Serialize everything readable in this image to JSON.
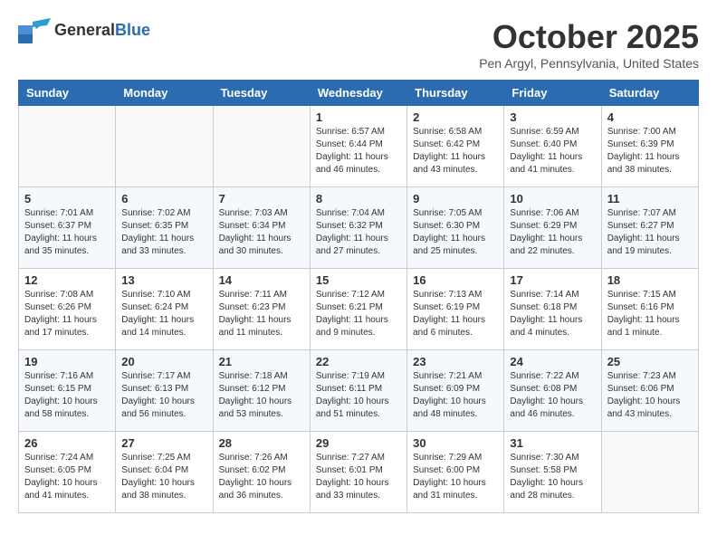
{
  "header": {
    "logo_general": "General",
    "logo_blue": "Blue",
    "month_title": "October 2025",
    "location": "Pen Argyl, Pennsylvania, United States"
  },
  "weekdays": [
    "Sunday",
    "Monday",
    "Tuesday",
    "Wednesday",
    "Thursday",
    "Friday",
    "Saturday"
  ],
  "weeks": [
    [
      {
        "day": "",
        "empty": true
      },
      {
        "day": "",
        "empty": true
      },
      {
        "day": "",
        "empty": true
      },
      {
        "day": "1",
        "sunrise": "6:57 AM",
        "sunset": "6:44 PM",
        "daylight": "11 hours and 46 minutes."
      },
      {
        "day": "2",
        "sunrise": "6:58 AM",
        "sunset": "6:42 PM",
        "daylight": "11 hours and 43 minutes."
      },
      {
        "day": "3",
        "sunrise": "6:59 AM",
        "sunset": "6:40 PM",
        "daylight": "11 hours and 41 minutes."
      },
      {
        "day": "4",
        "sunrise": "7:00 AM",
        "sunset": "6:39 PM",
        "daylight": "11 hours and 38 minutes."
      }
    ],
    [
      {
        "day": "5",
        "sunrise": "7:01 AM",
        "sunset": "6:37 PM",
        "daylight": "11 hours and 35 minutes."
      },
      {
        "day": "6",
        "sunrise": "7:02 AM",
        "sunset": "6:35 PM",
        "daylight": "11 hours and 33 minutes."
      },
      {
        "day": "7",
        "sunrise": "7:03 AM",
        "sunset": "6:34 PM",
        "daylight": "11 hours and 30 minutes."
      },
      {
        "day": "8",
        "sunrise": "7:04 AM",
        "sunset": "6:32 PM",
        "daylight": "11 hours and 27 minutes."
      },
      {
        "day": "9",
        "sunrise": "7:05 AM",
        "sunset": "6:30 PM",
        "daylight": "11 hours and 25 minutes."
      },
      {
        "day": "10",
        "sunrise": "7:06 AM",
        "sunset": "6:29 PM",
        "daylight": "11 hours and 22 minutes."
      },
      {
        "day": "11",
        "sunrise": "7:07 AM",
        "sunset": "6:27 PM",
        "daylight": "11 hours and 19 minutes."
      }
    ],
    [
      {
        "day": "12",
        "sunrise": "7:08 AM",
        "sunset": "6:26 PM",
        "daylight": "11 hours and 17 minutes."
      },
      {
        "day": "13",
        "sunrise": "7:10 AM",
        "sunset": "6:24 PM",
        "daylight": "11 hours and 14 minutes."
      },
      {
        "day": "14",
        "sunrise": "7:11 AM",
        "sunset": "6:23 PM",
        "daylight": "11 hours and 11 minutes."
      },
      {
        "day": "15",
        "sunrise": "7:12 AM",
        "sunset": "6:21 PM",
        "daylight": "11 hours and 9 minutes."
      },
      {
        "day": "16",
        "sunrise": "7:13 AM",
        "sunset": "6:19 PM",
        "daylight": "11 hours and 6 minutes."
      },
      {
        "day": "17",
        "sunrise": "7:14 AM",
        "sunset": "6:18 PM",
        "daylight": "11 hours and 4 minutes."
      },
      {
        "day": "18",
        "sunrise": "7:15 AM",
        "sunset": "6:16 PM",
        "daylight": "11 hours and 1 minute."
      }
    ],
    [
      {
        "day": "19",
        "sunrise": "7:16 AM",
        "sunset": "6:15 PM",
        "daylight": "10 hours and 58 minutes."
      },
      {
        "day": "20",
        "sunrise": "7:17 AM",
        "sunset": "6:13 PM",
        "daylight": "10 hours and 56 minutes."
      },
      {
        "day": "21",
        "sunrise": "7:18 AM",
        "sunset": "6:12 PM",
        "daylight": "10 hours and 53 minutes."
      },
      {
        "day": "22",
        "sunrise": "7:19 AM",
        "sunset": "6:11 PM",
        "daylight": "10 hours and 51 minutes."
      },
      {
        "day": "23",
        "sunrise": "7:21 AM",
        "sunset": "6:09 PM",
        "daylight": "10 hours and 48 minutes."
      },
      {
        "day": "24",
        "sunrise": "7:22 AM",
        "sunset": "6:08 PM",
        "daylight": "10 hours and 46 minutes."
      },
      {
        "day": "25",
        "sunrise": "7:23 AM",
        "sunset": "6:06 PM",
        "daylight": "10 hours and 43 minutes."
      }
    ],
    [
      {
        "day": "26",
        "sunrise": "7:24 AM",
        "sunset": "6:05 PM",
        "daylight": "10 hours and 41 minutes."
      },
      {
        "day": "27",
        "sunrise": "7:25 AM",
        "sunset": "6:04 PM",
        "daylight": "10 hours and 38 minutes."
      },
      {
        "day": "28",
        "sunrise": "7:26 AM",
        "sunset": "6:02 PM",
        "daylight": "10 hours and 36 minutes."
      },
      {
        "day": "29",
        "sunrise": "7:27 AM",
        "sunset": "6:01 PM",
        "daylight": "10 hours and 33 minutes."
      },
      {
        "day": "30",
        "sunrise": "7:29 AM",
        "sunset": "6:00 PM",
        "daylight": "10 hours and 31 minutes."
      },
      {
        "day": "31",
        "sunrise": "7:30 AM",
        "sunset": "5:58 PM",
        "daylight": "10 hours and 28 minutes."
      },
      {
        "day": "",
        "empty": true
      }
    ]
  ]
}
